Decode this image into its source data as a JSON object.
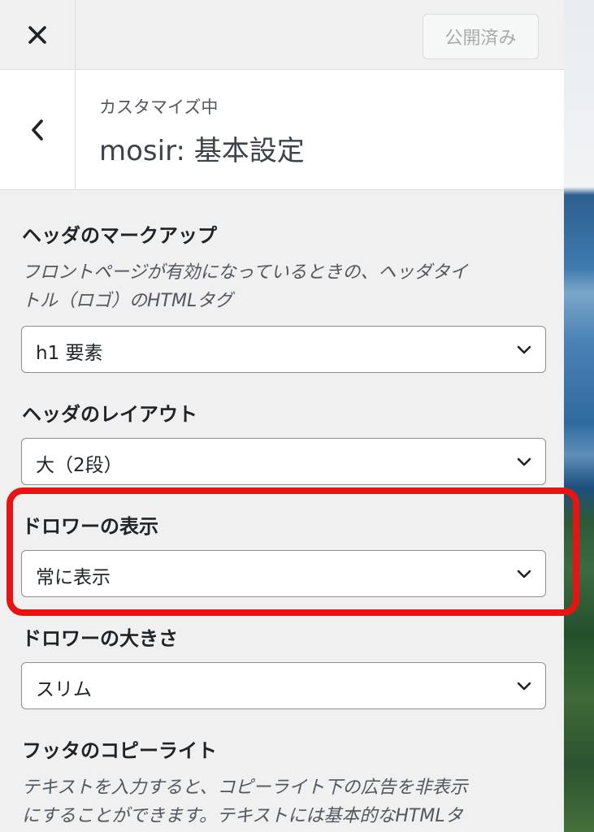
{
  "topbar": {
    "close_icon": "close-icon",
    "publish_label": "公開済み"
  },
  "section": {
    "back_icon": "chevron-left-icon",
    "subtitle": "カスタマイズ中",
    "title": "mosir: 基本設定"
  },
  "controls": {
    "header_markup": {
      "title": "ヘッダのマークアップ",
      "desc_line1": "フロントページが有効になっているときの、ヘッダタイ",
      "desc_line2": "トル（ロゴ）のHTMLタグ",
      "value": "h1 要素"
    },
    "header_layout": {
      "title": "ヘッダのレイアウト",
      "value": "大（2段）"
    },
    "drawer_display": {
      "title": "ドロワーの表示",
      "value": "常に表示"
    },
    "drawer_size": {
      "title": "ドロワーの大きさ",
      "value": "スリム"
    },
    "footer_copyright": {
      "title": "フッタのコピーライト",
      "desc_line1": "テキストを入力すると、コピーライト下の広告を非表示",
      "desc_line2": "にすることができます。テキストには基本的なHTMLタ"
    }
  },
  "colors": {
    "highlight": "#e81414",
    "panel_bg": "#f0f0f1"
  }
}
